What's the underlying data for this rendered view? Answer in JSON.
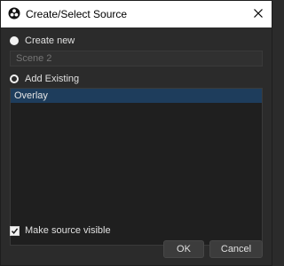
{
  "window": {
    "title": "Create/Select Source",
    "app_icon": "obs-logo-icon",
    "close_icon": "close-icon"
  },
  "create_new": {
    "label": "Create new",
    "selected": false,
    "name_placeholder": "Scene 2",
    "name_value": ""
  },
  "add_existing": {
    "label": "Add Existing",
    "selected": true,
    "items": [
      {
        "label": "Overlay",
        "selected": true
      }
    ]
  },
  "make_visible": {
    "label": "Make source visible",
    "checked": true
  },
  "buttons": {
    "ok": "OK",
    "cancel": "Cancel"
  },
  "colors": {
    "background": "#2b2b2b",
    "list_background": "#1f1f1f",
    "selection": "#1e3d5c",
    "titlebar": "#ffffff"
  }
}
